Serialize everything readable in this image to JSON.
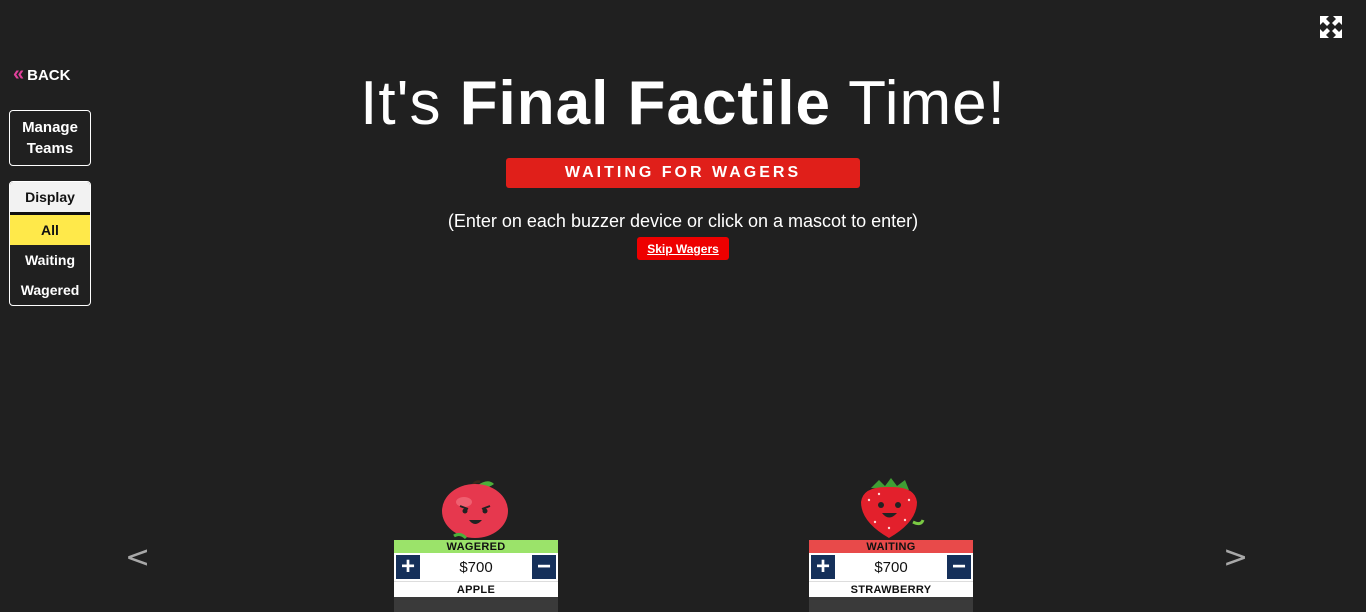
{
  "nav": {
    "back_label": "BACK",
    "back_icon": "double-chevron-left",
    "manage_teams_label": "Manage Teams",
    "fullscreen_icon": "expand-arrows-icon"
  },
  "display_filter": {
    "header": "Display",
    "options": [
      "All",
      "Waiting",
      "Wagered"
    ],
    "selected": "All",
    "selected_color": "#ffe94a"
  },
  "main": {
    "title_prefix": "It's",
    "title_bold": "Final Factile",
    "title_suffix": "Time!",
    "status_banner": "WAITING FOR WAGERS",
    "instructions": "(Enter on each buzzer device or click on a mascot to enter)",
    "skip_label": "Skip Wagers"
  },
  "carousel": {
    "prev": "<",
    "next": ">"
  },
  "teams": [
    {
      "name": "APPLE",
      "status": "WAGERED",
      "status_color": "#9be36a",
      "wager": "$700",
      "mascot": "apple-mascot"
    },
    {
      "name": "STRAWBERRY",
      "status": "WAITING",
      "status_color": "#e84a4a",
      "wager": "$700",
      "mascot": "strawberry-mascot"
    }
  ],
  "colors": {
    "background": "#202020",
    "banner_red": "#e01f1a",
    "skip_red": "#ee0000",
    "control_navy": "#15305a",
    "back_chevron": "#e0409a"
  }
}
